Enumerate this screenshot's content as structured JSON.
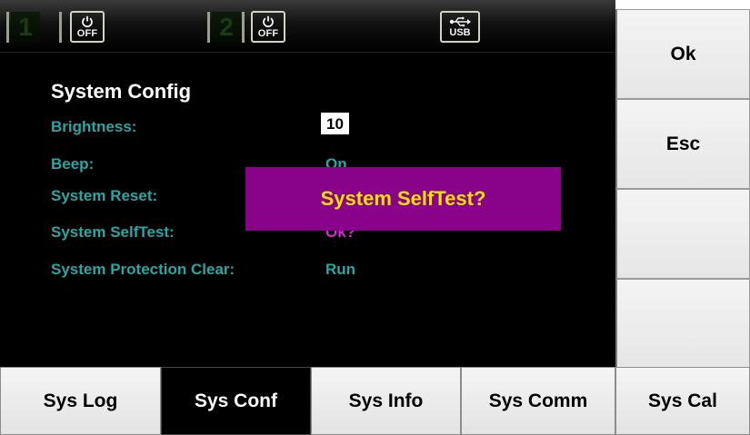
{
  "status_bar": {
    "channel1_number": "1",
    "channel1_power": "OFF",
    "channel2_number": "2",
    "channel2_power": "OFF",
    "usb_label": "USB"
  },
  "page": {
    "title": "System Config",
    "rows": [
      {
        "label": "Brightness:",
        "value": "10"
      },
      {
        "label": "Beep:",
        "value": "On"
      },
      {
        "label": "System Reset:",
        "value": ""
      },
      {
        "label": "System SelfTest:",
        "value": "Ok?"
      },
      {
        "label": "System Protection Clear:",
        "value": "Run"
      }
    ]
  },
  "dialog": {
    "message": "System SelfTest?"
  },
  "side_keys": [
    {
      "label": "Ok"
    },
    {
      "label": "Esc"
    },
    {
      "label": ""
    },
    {
      "label": ""
    }
  ],
  "bottom_keys": [
    {
      "label": "Sys Log",
      "active": false
    },
    {
      "label": "Sys Conf",
      "active": true
    },
    {
      "label": "Sys Info",
      "active": false
    },
    {
      "label": "Sys Comm",
      "active": false
    },
    {
      "label": "Sys Cal",
      "active": false
    }
  ],
  "colors": {
    "label_teal": "#2aa6a4",
    "dialog_bg": "#88038a",
    "dialog_text": "#ffe200",
    "selected_value": "#d52bd6"
  }
}
